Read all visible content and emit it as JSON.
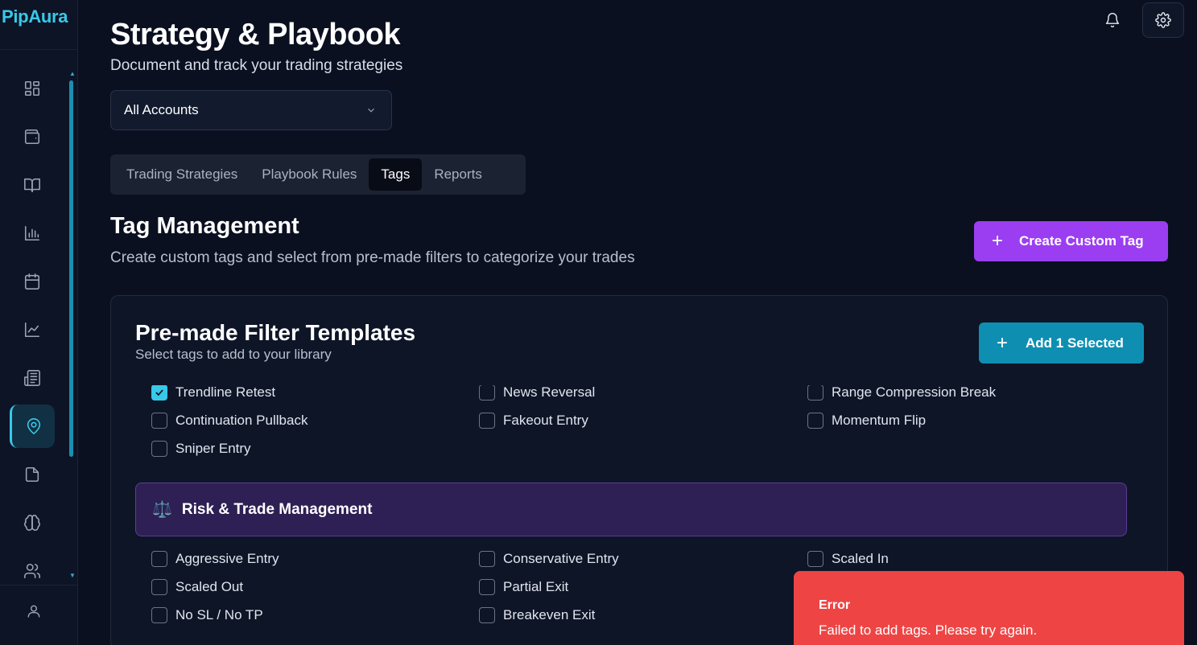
{
  "app": {
    "logo": "PipAura"
  },
  "sidebar": {
    "items": [
      {
        "icon": "dashboard-icon",
        "active": false
      },
      {
        "icon": "wallet-icon",
        "active": false
      },
      {
        "icon": "journal-book-icon",
        "active": false
      },
      {
        "icon": "bar-chart-icon",
        "active": false
      },
      {
        "icon": "calendar-icon",
        "active": false
      },
      {
        "icon": "line-chart-icon",
        "active": false
      },
      {
        "icon": "newspaper-icon",
        "active": false
      },
      {
        "icon": "map-pin-icon",
        "active": true
      },
      {
        "icon": "document-icon",
        "active": false
      },
      {
        "icon": "brain-icon",
        "active": false
      },
      {
        "icon": "users-icon",
        "active": false
      }
    ]
  },
  "header": {
    "title": "Strategy & Playbook",
    "subtitle": "Document and track your trading strategies",
    "account_select": "All Accounts"
  },
  "tabs": [
    {
      "label": "Trading Strategies",
      "active": false
    },
    {
      "label": "Playbook Rules",
      "active": false
    },
    {
      "label": "Tags",
      "active": true
    },
    {
      "label": "Reports",
      "active": false
    }
  ],
  "tag_management": {
    "title": "Tag Management",
    "subtitle": "Create custom tags and select from pre-made filters to categorize your trades",
    "create_button": "Create Custom Tag"
  },
  "templates": {
    "title": "Pre-made Filter Templates",
    "subtitle": "Select tags to add to your library",
    "add_button": "Add 1 Selected",
    "entry_tags": [
      {
        "label": "Trendline Retest",
        "checked": true
      },
      {
        "label": "News Reversal",
        "checked": false
      },
      {
        "label": "Range Compression Break",
        "checked": false
      },
      {
        "label": "Continuation Pullback",
        "checked": false
      },
      {
        "label": "Fakeout Entry",
        "checked": false
      },
      {
        "label": "Momentum Flip",
        "checked": false
      },
      {
        "label": "Sniper Entry",
        "checked": false
      }
    ],
    "risk_section": {
      "emoji": "⚖️",
      "title": "Risk & Trade Management"
    },
    "risk_tags": [
      {
        "label": "Aggressive Entry",
        "checked": false
      },
      {
        "label": "Conservative Entry",
        "checked": false
      },
      {
        "label": "Scaled In",
        "checked": false
      },
      {
        "label": "Scaled Out",
        "checked": false
      },
      {
        "label": "Partial Exit",
        "checked": false
      },
      {
        "label": "No SL / No TP",
        "checked": false
      },
      {
        "label": "Breakeven Exit",
        "checked": false
      }
    ]
  },
  "toast": {
    "title": "Error",
    "message": "Failed to add tags. Please try again.",
    "color": "#ef4444"
  }
}
